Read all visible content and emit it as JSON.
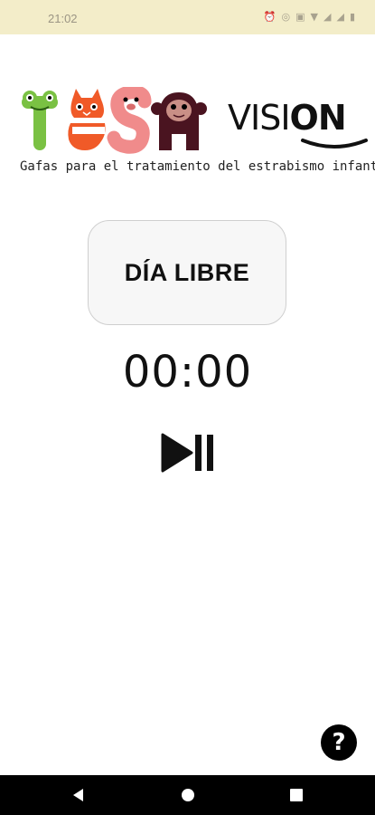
{
  "status_bar": {
    "time": "21:02",
    "icons": [
      "alarm-icon",
      "data-saver-icon",
      "nfc-icon",
      "wifi-icon",
      "signal-icon",
      "signal-icon",
      "battery-icon"
    ]
  },
  "logo": {
    "brand_letters": "TESA",
    "vision_prefix": "VISI",
    "vision_bold": "ON",
    "tagline": "Gafas para el tratamiento del estrabismo infantil",
    "colors": {
      "frog": "#7ac143",
      "cat": "#f05a28",
      "pig": "#f08b8b",
      "monkey": "#4a1420"
    }
  },
  "mode": {
    "label": "DÍA LIBRE"
  },
  "timer": {
    "value": "00:00"
  },
  "controls": {
    "play_pause_icon": "play-pause-icon"
  },
  "help": {
    "label": "?"
  },
  "nav": {
    "back_icon": "back-icon",
    "home_icon": "home-icon",
    "recents_icon": "recents-icon"
  }
}
